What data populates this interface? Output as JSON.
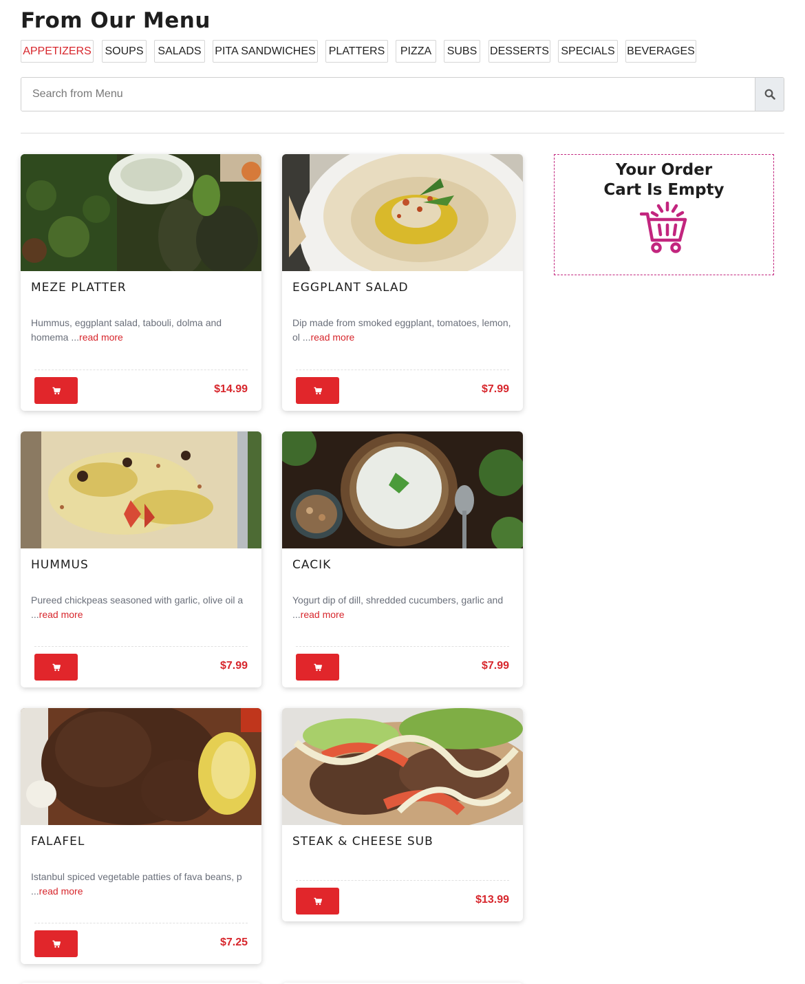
{
  "page": {
    "title": "From Our Menu"
  },
  "categories": [
    {
      "label": "APPETIZERS",
      "active": true
    },
    {
      "label": "SOUPS"
    },
    {
      "label": "SALADS"
    },
    {
      "label": "PITA SANDWICHES"
    },
    {
      "label": "PLATTERS"
    },
    {
      "label": "PIZZA"
    },
    {
      "label": "SUBS"
    },
    {
      "label": "DESSERTS"
    },
    {
      "label": "SPECIALS"
    },
    {
      "label": "BEVERAGES"
    }
  ],
  "search": {
    "placeholder": "Search from Menu",
    "value": "",
    "icon": "search-icon"
  },
  "colors": {
    "accent": "#e1262b",
    "price": "#d7262c",
    "cart_outline": "#c2257e"
  },
  "items": [
    {
      "name": "MEZE PLATTER",
      "desc": "Hummus, eggplant salad, tabouli, dolma and homema ...",
      "read_more": "read more",
      "price": "$14.99"
    },
    {
      "name": "EGGPLANT SALAD",
      "desc": "Dip made from smoked eggplant, tomatoes, lemon, ol ...",
      "read_more": "read more",
      "price": "$7.99"
    },
    {
      "name": "HUMMUS",
      "desc": "Pureed chickpeas seasoned with garlic, olive oil a ...",
      "read_more": "read more",
      "price": "$7.99"
    },
    {
      "name": "CACIK",
      "desc": "Yogurt dip of dill, shredded cucumbers, garlic and ...",
      "read_more": "read more",
      "price": "$7.99"
    },
    {
      "name": "FALAFEL",
      "desc": "Istanbul spiced vegetable patties of fava beans, p ...",
      "read_more": "read more",
      "price": "$7.25"
    },
    {
      "name": "STEAK & CHEESE SUB",
      "price": "$13.99"
    }
  ],
  "order": {
    "title_line1": "Your Order",
    "title_line2": "Cart Is Empty",
    "icon": "shopping-cart-icon"
  }
}
